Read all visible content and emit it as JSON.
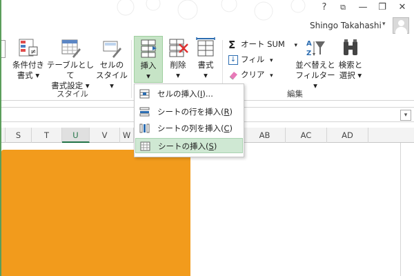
{
  "titlebar": {
    "help": "?",
    "restore_ribbon": "⧉",
    "minimize": "—",
    "maximize": "❐",
    "close": "✕"
  },
  "user": {
    "name": "Shingo Takahashi",
    "caret": "▾"
  },
  "ribbon": {
    "styles": {
      "conditional": [
        "条件付き",
        "書式 ▾"
      ],
      "as_table": [
        "テーブルとして",
        "書式設定 ▾"
      ],
      "cell_styles": [
        "セルの",
        "スタイル ▾"
      ],
      "group_label": "スタイル"
    },
    "cells": {
      "insert": [
        "挿入",
        "▾"
      ],
      "delete": [
        "削除",
        "▾"
      ],
      "format": [
        "書式",
        "▾"
      ]
    },
    "editing": {
      "autosum": "オート SUM",
      "autosum_caret": "▾",
      "fill": "フィル",
      "fill_caret": "▾",
      "clear": "クリア",
      "clear_caret": "▾",
      "sort_filter": [
        "並べ替えと",
        "フィルター ▾"
      ],
      "find_select": [
        "検索と",
        "選択 ▾"
      ],
      "group_label": "編集"
    }
  },
  "columns": [
    "S",
    "T",
    "U",
    "V",
    "W",
    "AB",
    "AC",
    "AD"
  ],
  "selected_column": "U",
  "insert_menu": {
    "items": [
      {
        "label": "セルの挿入(",
        "key": "I",
        "suffix": ")..."
      },
      {
        "label": "シートの行を挿入(",
        "key": "R",
        "suffix": ")"
      },
      {
        "label": "シートの列を挿入(",
        "key": "C",
        "suffix": ")"
      },
      {
        "label": "シートの挿入(",
        "key": "S",
        "suffix": ")"
      }
    ],
    "highlighted_index": 3
  },
  "colors": {
    "accent_green": "#217346",
    "orange_fill": "#f29b1c",
    "menu_highlight": "#cfe8d3"
  }
}
